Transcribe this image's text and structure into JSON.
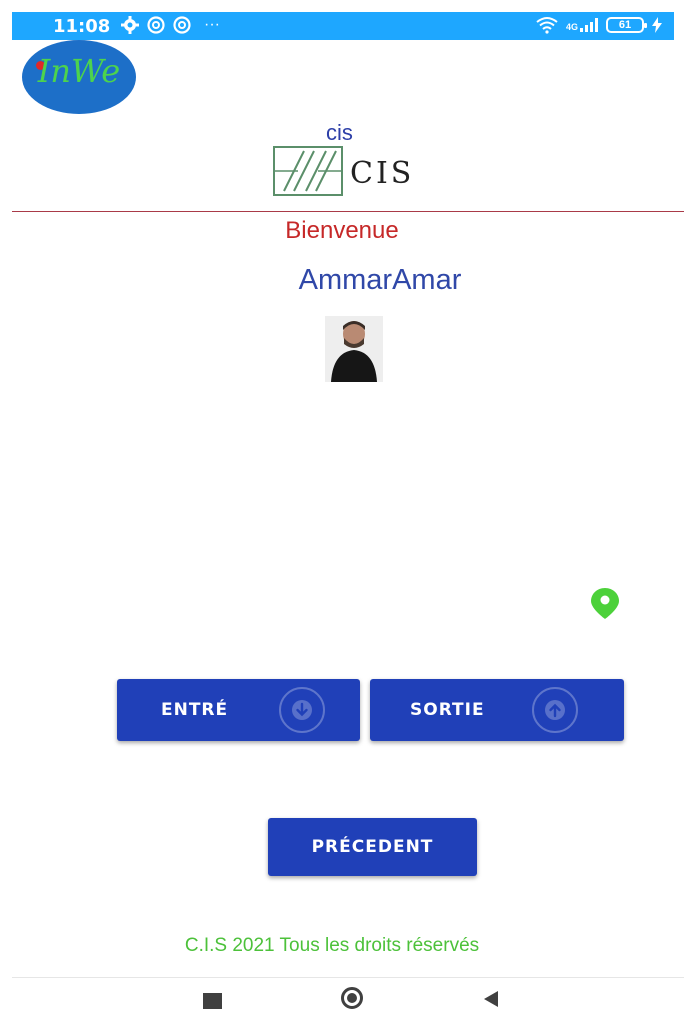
{
  "status_bar": {
    "time": "11:08",
    "more": "···",
    "network": "4G",
    "battery": "61",
    "background_color": "#1ea7ff"
  },
  "header": {
    "app_logo_text": "InWe",
    "company_small": "cis",
    "company_logo_text": "CIS"
  },
  "main": {
    "welcome": "Bienvenue",
    "username": "AmmarAmar"
  },
  "actions": {
    "entry_label": "ENTRÉ",
    "entry_icon": "arrow-down-circle-icon",
    "exit_label": "SORTIE",
    "exit_icon": "arrow-up-circle-icon",
    "previous_label": "PRÉCEDENT",
    "button_color": "#2040b8"
  },
  "footer": {
    "copyright": "C.I.S 2021 Tous les droits réservés"
  },
  "colors": {
    "welcome": "#c62828",
    "username": "#3048a8",
    "footer": "#4cc13a",
    "location_pin": "#4cd13a"
  }
}
